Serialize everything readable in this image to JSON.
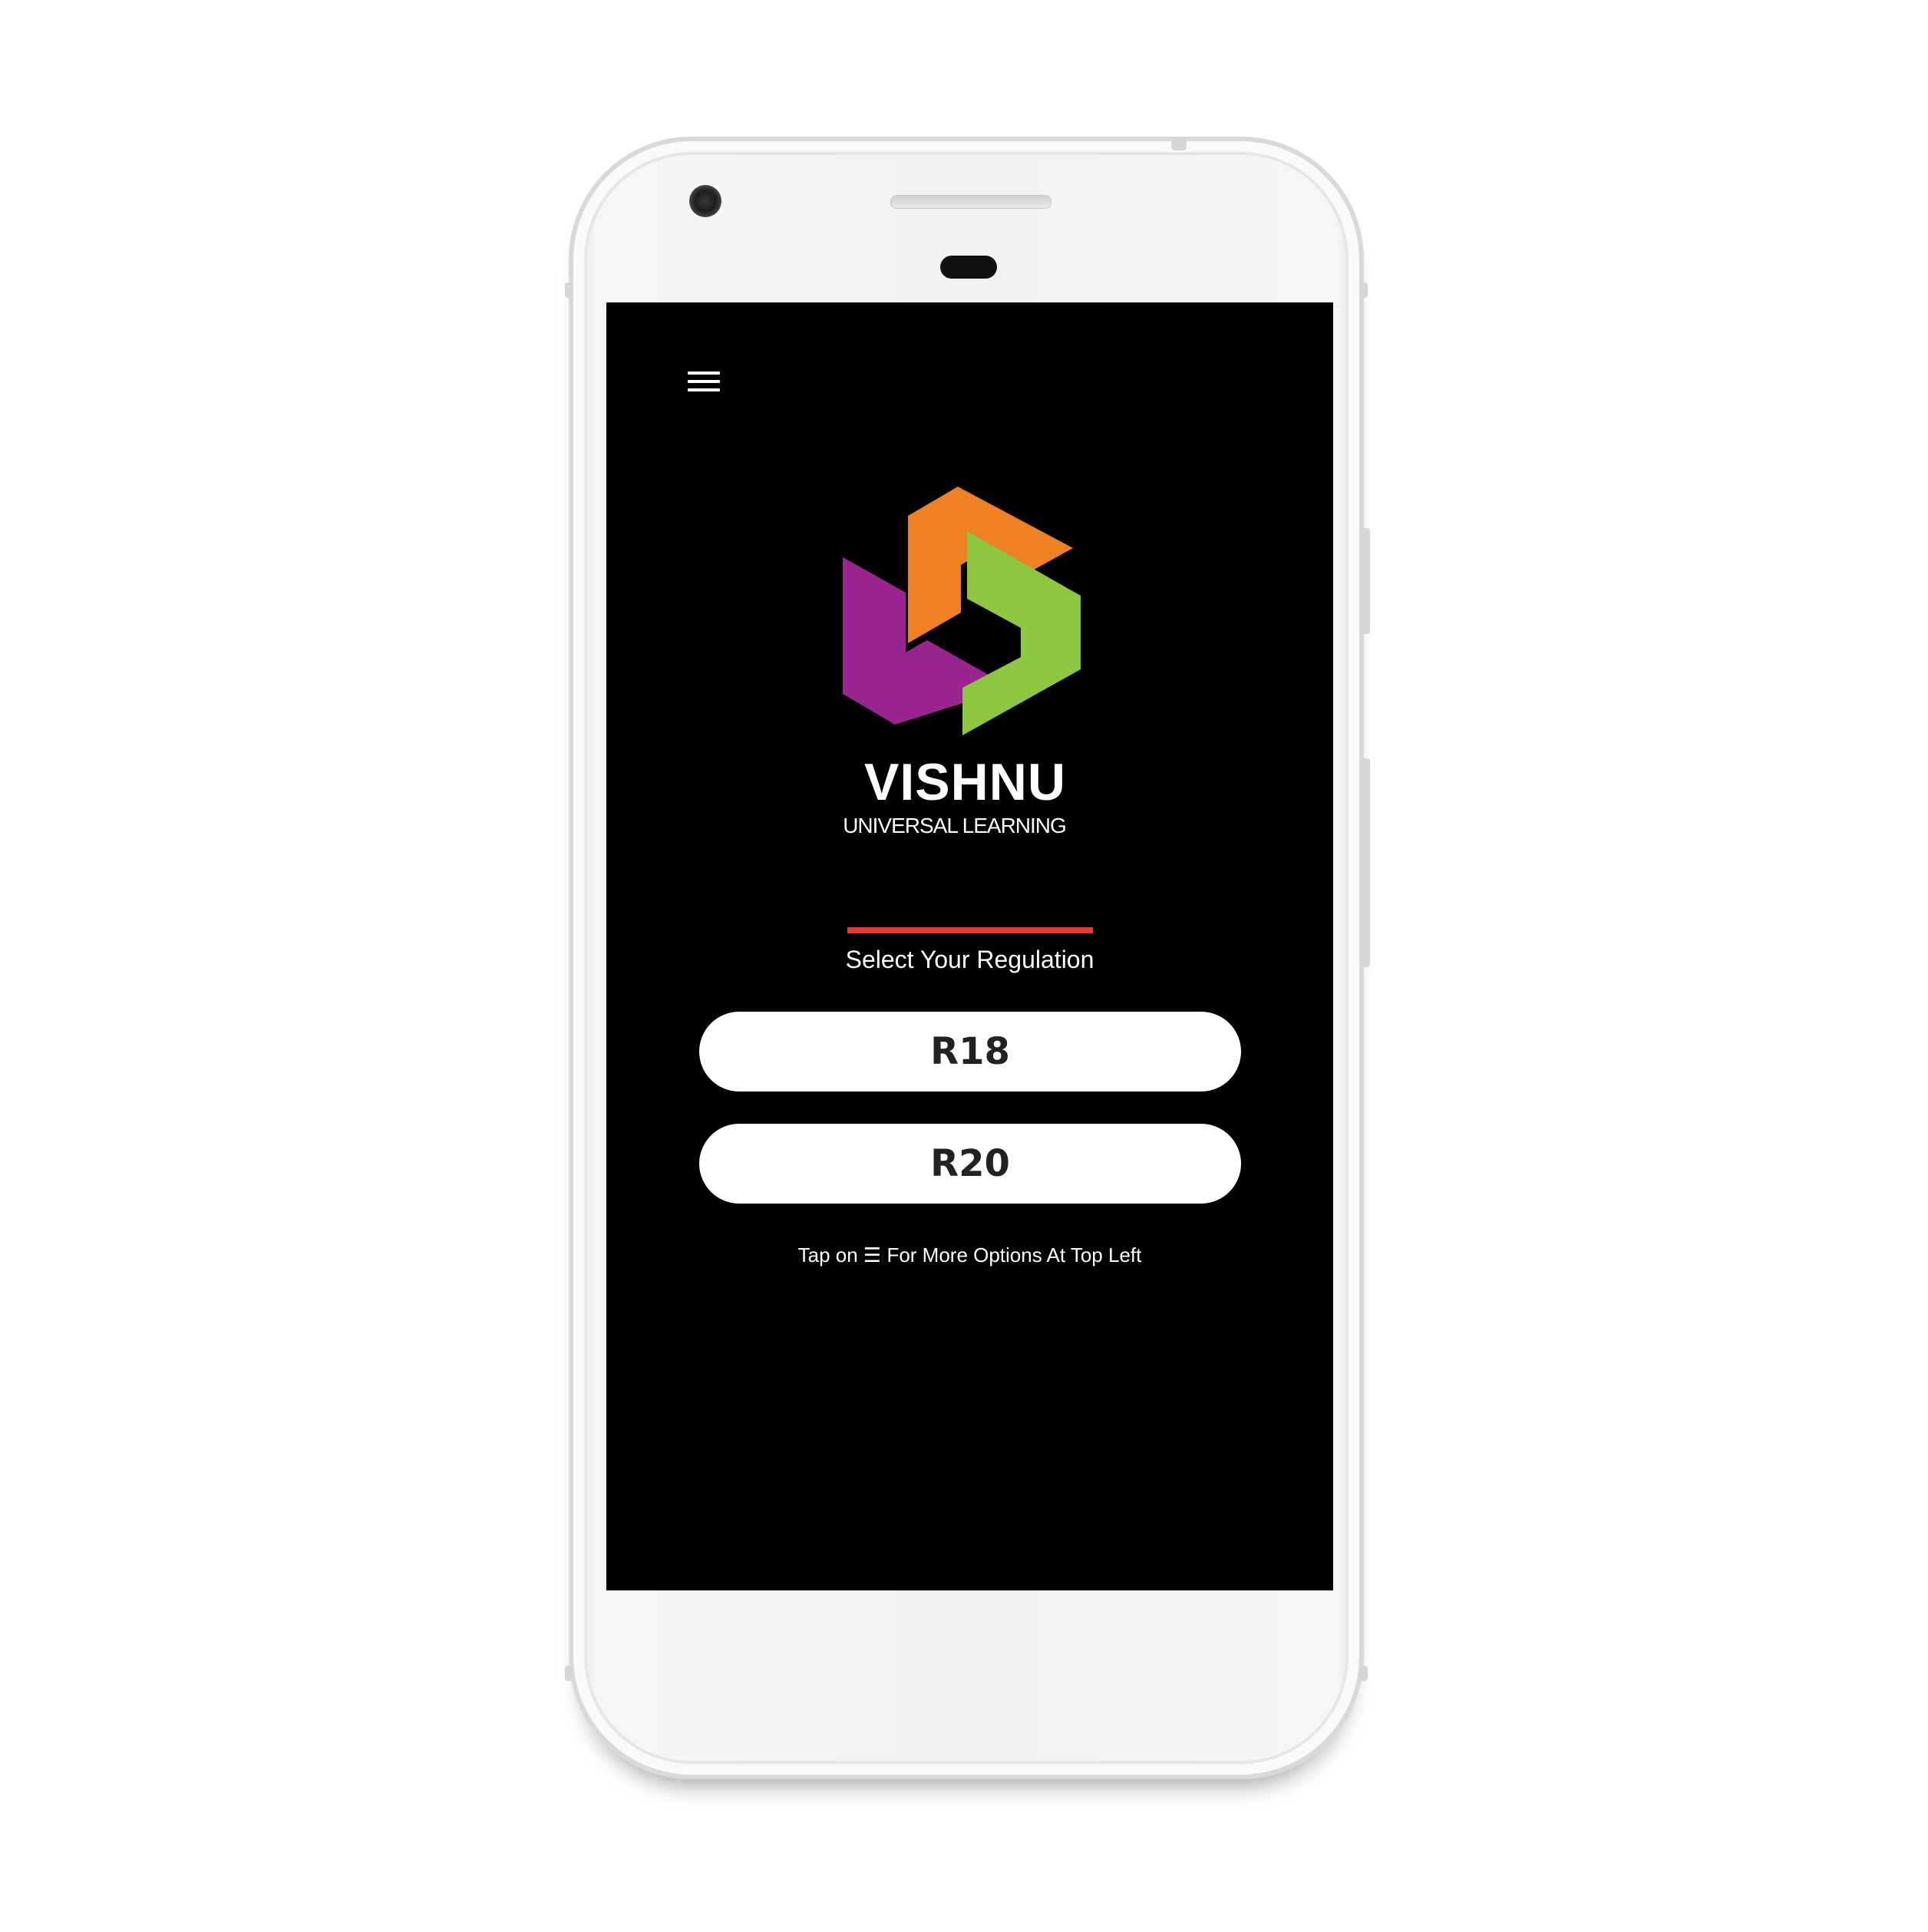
{
  "app": {
    "brand_name": "VISHNU",
    "brand_subtitle": "UNIVERSAL LEARNING",
    "prompt": "Select Your Regulation",
    "regulations": [
      "R18",
      "R20"
    ],
    "hint": "Tap on ☰ For More Options At Top Left"
  },
  "colors": {
    "screen_bg": "#000000",
    "accent_line": "#e53935",
    "logo_orange": "#ee8222",
    "logo_green": "#8dc63f",
    "logo_purple": "#9b2490",
    "button_bg": "#ffffff",
    "button_text": "#222222"
  },
  "icons": {
    "menu": "hamburger-menu-icon"
  }
}
